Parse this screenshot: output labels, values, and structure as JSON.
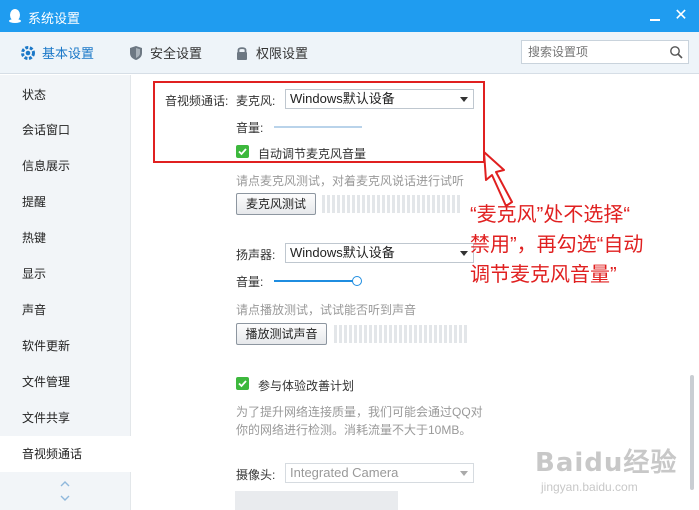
{
  "window": {
    "title": "系统设置",
    "close_glyph": "✕"
  },
  "tabs": [
    {
      "label": "基本设置",
      "icon": "gear-icon"
    },
    {
      "label": "安全设置",
      "icon": "shield-icon"
    },
    {
      "label": "权限设置",
      "icon": "lock-icon"
    }
  ],
  "search": {
    "placeholder": "搜索设置项"
  },
  "sidebar": {
    "items": [
      {
        "label": "状态"
      },
      {
        "label": "会话窗口"
      },
      {
        "label": "信息展示"
      },
      {
        "label": "提醒"
      },
      {
        "label": "热键"
      },
      {
        "label": "显示"
      },
      {
        "label": "声音"
      },
      {
        "label": "软件更新"
      },
      {
        "label": "文件管理"
      },
      {
        "label": "文件共享"
      },
      {
        "label": "音视频通话"
      }
    ],
    "active_index": 10
  },
  "av": {
    "section_label": "音视频通话:",
    "mic": {
      "label": "麦克风:",
      "device": "Windows默认设备",
      "volume_label": "音量:",
      "volume_level": 0.0,
      "auto_adjust_label": "自动调节麦克风音量",
      "auto_adjust_checked": true,
      "test_hint": "请点麦克风测试，对着麦克风说话进行试听",
      "test_button": "麦克风测试"
    },
    "speaker": {
      "label": "扬声器:",
      "device": "Windows默认设备",
      "volume_label": "音量:",
      "volume_level": 1.0,
      "test_hint": "请点播放测试，试试能否听到声音",
      "test_button": "播放测试声音"
    },
    "experience": {
      "label": "参与体验改善计划",
      "checked": true,
      "desc_line1": "为了提升网络连接质量，我们可能会通过QQ对",
      "desc_line2": "你的网络进行检测。消耗流量不大于10MB。"
    },
    "camera": {
      "label": "摄像头:",
      "device": "Integrated Camera"
    }
  },
  "annotation": {
    "line1": "“麦克风”处不选择“",
    "line2": "禁用”，再勾选“自动",
    "line3": "调节麦克风音量”",
    "color": "#e02020"
  },
  "watermark": {
    "brand": "Baidu经验",
    "url": "jingyan.baidu.com"
  },
  "colors": {
    "titlebar": "#1f9cf0",
    "accent": "#1b78c8",
    "check": "#3db83d",
    "annotation": "#e02020"
  }
}
